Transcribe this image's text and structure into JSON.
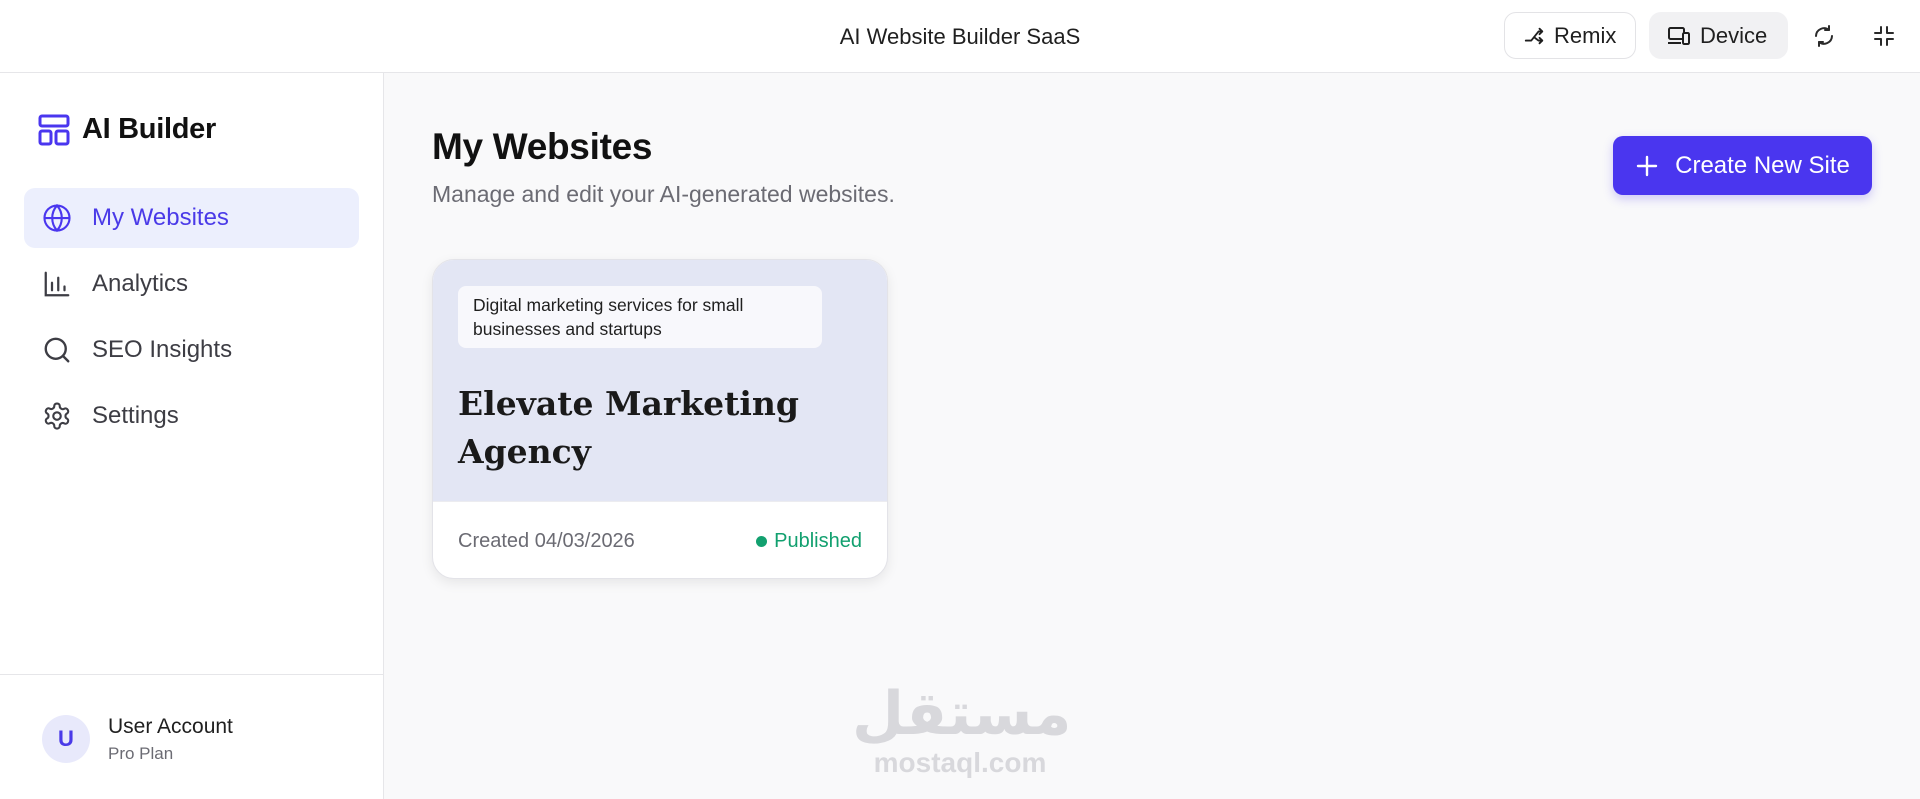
{
  "topbar": {
    "title": "AI Website Builder SaaS",
    "remix_label": "Remix",
    "device_label": "Device"
  },
  "sidebar": {
    "brand": "AI Builder",
    "items": [
      {
        "label": "My Websites",
        "icon": "globe-icon",
        "active": true
      },
      {
        "label": "Analytics",
        "icon": "bar-chart-icon",
        "active": false
      },
      {
        "label": "SEO Insights",
        "icon": "search-icon",
        "active": false
      },
      {
        "label": "Settings",
        "icon": "gear-icon",
        "active": false
      }
    ],
    "user": {
      "initial": "U",
      "name": "User Account",
      "plan": "Pro Plan"
    }
  },
  "main": {
    "title": "My Websites",
    "subtitle": "Manage and edit your AI-generated websites.",
    "create_label": "Create New Site",
    "sites": [
      {
        "tagline": "Digital marketing services for small businesses and startups",
        "name": "Elevate Marketing Agency",
        "created": "Created 04/03/2026",
        "status": "Published"
      }
    ]
  },
  "watermark": {
    "arabic": "مستقل",
    "latin": "mostaql.com"
  },
  "colors": {
    "accent": "#4a36ef",
    "active_bg": "#eceffd",
    "published": "#12a06f",
    "card_top": "#e3e6f4"
  }
}
